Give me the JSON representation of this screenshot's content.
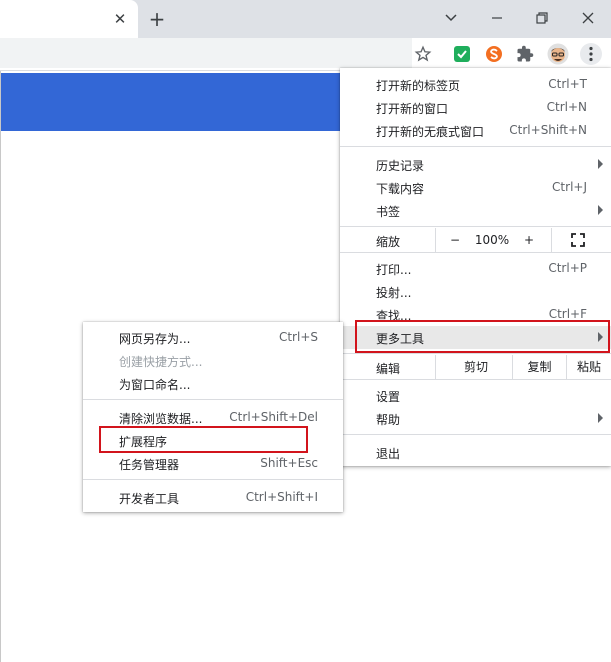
{
  "colors": {
    "accent_red": "#d2141c",
    "banner_blue": "#3367d6"
  },
  "tabstrip": {
    "close_glyph": "✕",
    "new_tab_glyph": "+"
  },
  "window_controls": {
    "tab_search_glyph": "⌵",
    "restore_glyph": "❐",
    "close_glyph": "✕"
  },
  "main_menu": {
    "items": {
      "new_tab": {
        "label": "打开新的标签页",
        "shortcut": "Ctrl+T"
      },
      "new_window": {
        "label": "打开新的窗口",
        "shortcut": "Ctrl+N"
      },
      "incognito": {
        "label": "打开新的无痕式窗口",
        "shortcut": "Ctrl+Shift+N"
      },
      "history": {
        "label": "历史记录"
      },
      "downloads": {
        "label": "下载内容",
        "shortcut": "Ctrl+J"
      },
      "bookmarks": {
        "label": "书签"
      },
      "print": {
        "label": "打印...",
        "shortcut": "Ctrl+P"
      },
      "cast": {
        "label": "投射..."
      },
      "find": {
        "label": "查找...",
        "shortcut": "Ctrl+F"
      },
      "more_tools": {
        "label": "更多工具"
      },
      "settings": {
        "label": "设置"
      },
      "help": {
        "label": "帮助"
      },
      "exit": {
        "label": "退出"
      }
    },
    "zoom": {
      "label": "缩放",
      "minus": "−",
      "value": "100%",
      "plus": "+"
    },
    "edit": {
      "label": "编辑",
      "cut": "剪切",
      "copy": "复制",
      "paste": "粘贴"
    }
  },
  "sub_menu": {
    "items": {
      "save_page": {
        "label": "网页另存为...",
        "shortcut": "Ctrl+S"
      },
      "create_shortcut": {
        "label": "创建快捷方式..."
      },
      "name_window": {
        "label": "为窗口命名..."
      },
      "clear_data": {
        "label": "清除浏览数据...",
        "shortcut": "Ctrl+Shift+Del"
      },
      "extensions": {
        "label": "扩展程序"
      },
      "task_manager": {
        "label": "任务管理器",
        "shortcut": "Shift+Esc"
      },
      "dev_tools": {
        "label": "开发者工具",
        "shortcut": "Ctrl+Shift+I"
      }
    }
  }
}
